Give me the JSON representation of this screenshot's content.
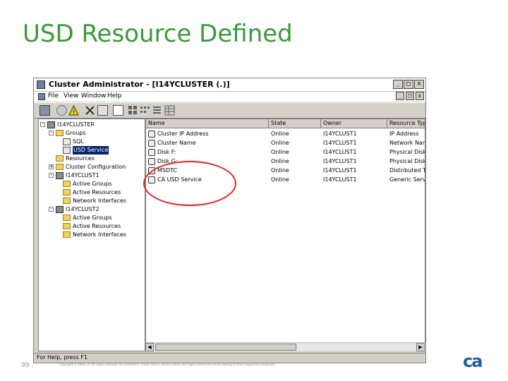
{
  "slide": {
    "title": "USD Resource Defined",
    "page_number": "99",
    "copyright": "Copyright © 2008 CA. All rights reserved. All trademarks, trade names, service marks and logos referenced herein belong to their respective companies.",
    "logo_text": "ca",
    "brand_color": "#1f5fa8",
    "title_color": "#3a9a3a"
  },
  "window": {
    "title": "Cluster Administrator - [I14YCLUSTER (.)]",
    "controls": [
      "_",
      "□",
      "x"
    ],
    "inner_controls": [
      "_",
      "□",
      "x"
    ]
  },
  "menu": [
    "File",
    "View",
    "Window",
    "Help"
  ],
  "toolbar": [
    "cluster-icon",
    "properties-icon",
    "warning-icon",
    "delete-icon",
    "check-icon",
    "filter-icon",
    "large-icons-icon",
    "small-icons-icon",
    "list-icon",
    "details-icon"
  ],
  "tree": [
    {
      "label": "I14YCLUSTER",
      "type": "server",
      "expander": "-"
    },
    {
      "label": "Groups",
      "type": "folder",
      "expander": "-"
    },
    {
      "label": "SQL",
      "type": "group",
      "expander": ""
    },
    {
      "label": "USD Service",
      "type": "group",
      "expander": "",
      "selected": true
    },
    {
      "label": "Resources",
      "type": "folder",
      "expander": ""
    },
    {
      "label": "Cluster Configuration",
      "type": "folder",
      "expander": "+"
    },
    {
      "label": "I14YCLUST1",
      "type": "server",
      "expander": "-"
    },
    {
      "label": "Active Groups",
      "type": "folder",
      "expander": ""
    },
    {
      "label": "Active Resources",
      "type": "folder",
      "expander": ""
    },
    {
      "label": "Network Interfaces",
      "type": "folder",
      "expander": ""
    },
    {
      "label": "I14YCLUST2",
      "type": "server",
      "expander": "-"
    },
    {
      "label": "Active Groups",
      "type": "folder",
      "expander": ""
    },
    {
      "label": "Active Resources",
      "type": "folder",
      "expander": ""
    },
    {
      "label": "Network Interfaces",
      "type": "folder",
      "expander": ""
    }
  ],
  "columns": [
    "Name",
    "State",
    "Owner",
    "Resource Type"
  ],
  "rows": [
    {
      "name": "Cluster IP Address",
      "state": "Online",
      "owner": "I14YCLUST1",
      "type": "IP Address"
    },
    {
      "name": "Cluster Name",
      "state": "Online",
      "owner": "I14YCLUST1",
      "type": "Network Name"
    },
    {
      "name": "Disk F:",
      "state": "Online",
      "owner": "I14YCLUST1",
      "type": "Physical Disk"
    },
    {
      "name": "Disk G:",
      "state": "Online",
      "owner": "I14YCLUST1",
      "type": "Physical Disk"
    },
    {
      "name": "MSDTC",
      "state": "Online",
      "owner": "I14YCLUST1",
      "type": "Distributed Tr"
    },
    {
      "name": "CA USD Service",
      "state": "Online",
      "owner": "I14YCLUST1",
      "type": "Generic Servi"
    }
  ],
  "status": "For Help, press F1",
  "highlight_color": "#e82020"
}
